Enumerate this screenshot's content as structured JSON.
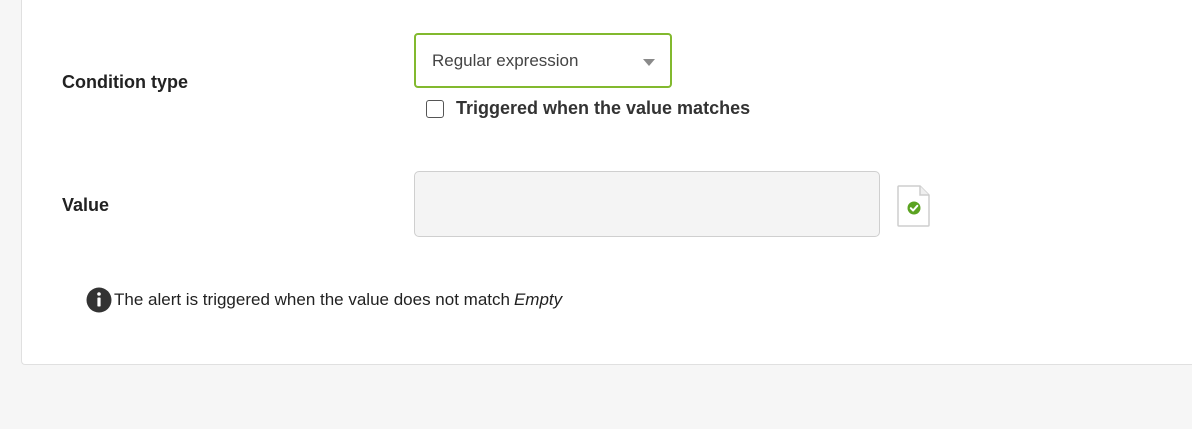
{
  "form": {
    "condition_type": {
      "label": "Condition type",
      "select_value": "Regular expression",
      "select_icon": "chevron-down-icon"
    },
    "checkbox": {
      "label": "Triggered when the value matches",
      "checked": false
    },
    "value_field": {
      "label": "Value",
      "value": "",
      "action_icon": "document-check-icon"
    },
    "info": {
      "icon": "info-icon",
      "text": "The alert is triggered when the value does not match",
      "emphasis": "Empty"
    }
  },
  "colors": {
    "select_border": "#82b92e",
    "check_badge": "#5ba321",
    "info_icon": "#333333"
  }
}
